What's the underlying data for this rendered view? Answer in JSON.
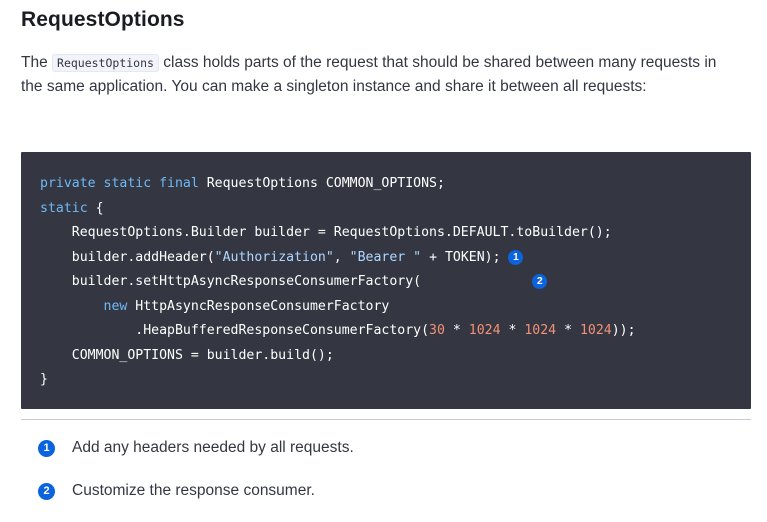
{
  "heading": "RequestOptions",
  "intro": {
    "before": "The ",
    "code": "RequestOptions",
    "after": " class holds parts of the request that should be shared between many requests in the same application. You can make a singleton instance and share it between all requests:"
  },
  "code": {
    "l1_kw": "private static final",
    "l1_rest": " RequestOptions COMMON_OPTIONS;",
    "l2_kw": "static",
    "l2_rest": " {",
    "l3": "    RequestOptions.Builder builder = RequestOptions.DEFAULT.toBuilder();",
    "l4_a": "    builder.addHeader(",
    "l4_s1": "\"Authorization\"",
    "l4_b": ", ",
    "l4_s2": "\"Bearer \"",
    "l4_c": " + TOKEN); ",
    "l5": "    builder.setHttpAsyncResponseConsumerFactory(              ",
    "l6_pad": "        ",
    "l6_kw": "new",
    "l6_rest": " HttpAsyncResponseConsumerFactory",
    "l7_a": "            .HeapBufferedResponseConsumerFactory(",
    "l7_n1": "30",
    "l7_op1": " * ",
    "l7_n2": "1024",
    "l7_op2": " * ",
    "l7_n3": "1024",
    "l7_op3": " * ",
    "l7_n4": "1024",
    "l7_end": "));",
    "l8": "    COMMON_OPTIONS = builder.build();",
    "l9": "}"
  },
  "callouts": [
    {
      "number": "1",
      "text": "Add any headers needed by all requests."
    },
    {
      "number": "2",
      "text": "Customize the response consumer."
    }
  ],
  "colors": {
    "code_background": "#343741",
    "keyword": "#6fb8f7",
    "string": "#aed7ff",
    "number": "#f29178",
    "callout_badge": "#0b64dd"
  }
}
